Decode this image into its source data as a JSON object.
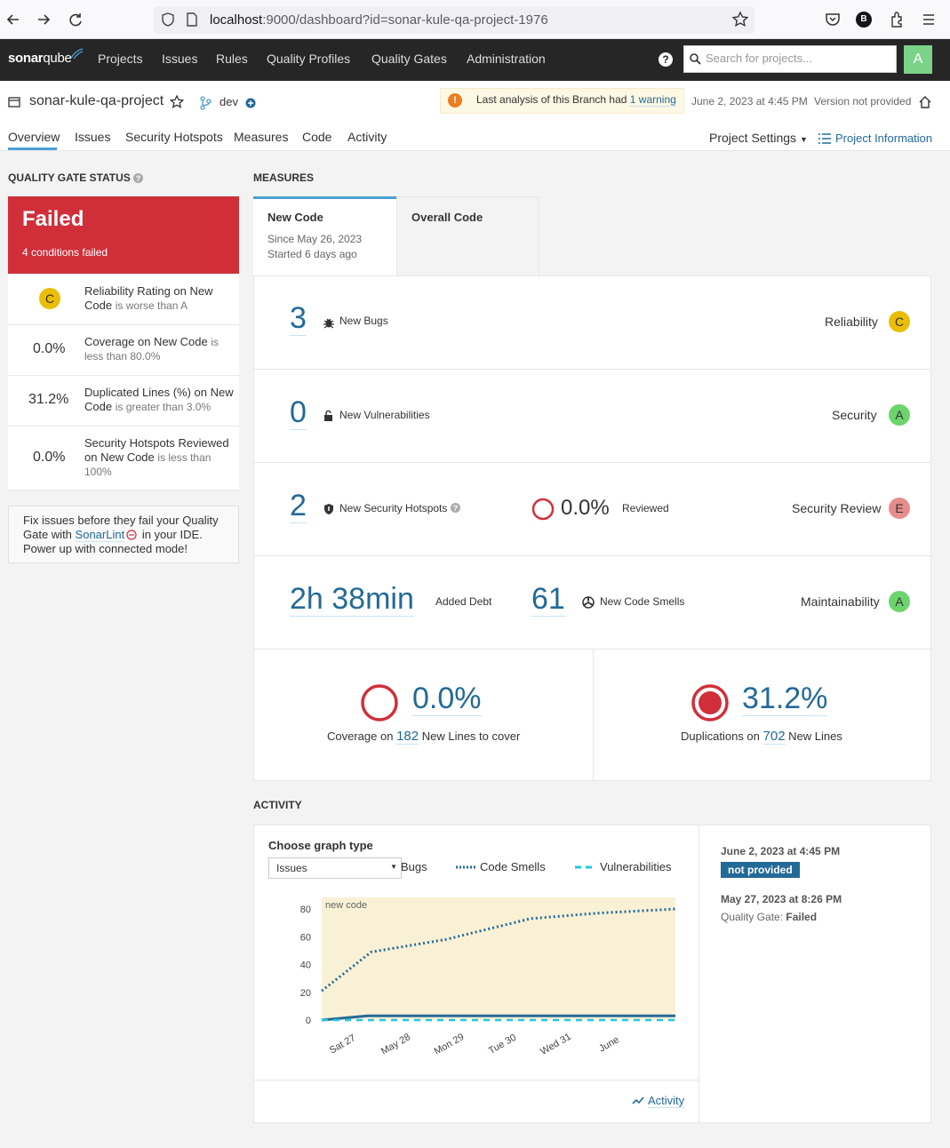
{
  "browser": {
    "url_host": "localhost",
    "url_rest": ":9000/dashboard?id=sonar-kule-qa-project-1976",
    "profile_initial": "B"
  },
  "nav": {
    "logo_bold": "sonar",
    "logo_light": "qube",
    "items": [
      "Projects",
      "Issues",
      "Rules",
      "Quality Profiles",
      "Quality Gates",
      "Administration"
    ],
    "help": "?",
    "search_placeholder": "Search for projects...",
    "avatar": "A"
  },
  "project": {
    "name": "sonar-kule-qa-project",
    "branch": "dev",
    "warning_text": "Last analysis of this Branch had",
    "warning_link": "1 warning",
    "warning_icon": "!",
    "analysis_date": "June 2, 2023 at 4:45 PM",
    "version": "Version not provided",
    "tabs": [
      "Overview",
      "Issues",
      "Security Hotspots",
      "Measures",
      "Code",
      "Activity"
    ],
    "settings": "Project Settings",
    "info": "Project Information"
  },
  "quality_gate": {
    "heading": "QUALITY GATE STATUS",
    "status": "Failed",
    "conditions_failed": "4 conditions failed",
    "conditions": [
      {
        "value": "C",
        "label": "Reliability Rating on New Code",
        "sub": "is worse than A"
      },
      {
        "value": "0.0%",
        "label": "Coverage on New Code",
        "sub": "is less than 80.0%"
      },
      {
        "value": "31.2%",
        "label": "Duplicated Lines (%) on New Code",
        "sub": "is greater than 3.0%"
      },
      {
        "value": "0.0%",
        "label": "Security Hotspots Reviewed on New Code",
        "sub": "is less than 100%"
      }
    ],
    "sonarlint_pre": "Fix issues before they fail your Quality Gate with",
    "sonarlint_link": "SonarLint",
    "sonarlint_post": "in your IDE. Power up with connected mode!"
  },
  "measures": {
    "heading": "MEASURES",
    "tab_new": {
      "title": "New Code",
      "since": "Since May 26, 2023",
      "started": "Started 6 days ago"
    },
    "tab_overall": {
      "title": "Overall Code"
    },
    "bugs": {
      "value": "3",
      "label": "New Bugs",
      "domain": "Reliability",
      "rating": "C"
    },
    "vulnerabilities": {
      "value": "0",
      "label": "New Vulnerabilities",
      "domain": "Security",
      "rating": "A"
    },
    "hotspots": {
      "value": "2",
      "label": "New Security Hotspots",
      "reviewed_value": "0.0%",
      "reviewed_label": "Reviewed",
      "domain": "Security Review",
      "rating": "E"
    },
    "maintainability": {
      "debt": "2h 38min",
      "debt_label": "Added Debt",
      "smells": "61",
      "smells_label": "New Code Smells",
      "domain": "Maintainability",
      "rating": "A"
    },
    "coverage": {
      "value": "0.0%",
      "pre": "Coverage on",
      "lines": "182",
      "post": "New Lines to cover"
    },
    "duplications": {
      "value": "31.2%",
      "pre": "Duplications on",
      "lines": "702",
      "post": "New Lines"
    }
  },
  "activity": {
    "heading": "ACTIVITY",
    "choose": "Choose graph type",
    "graph_type": "Issues",
    "legend": [
      "Bugs",
      "Code Smells",
      "Vulnerabilities"
    ],
    "history": [
      {
        "date": "June 2, 2023 at 4:45 PM",
        "badge": "not provided"
      },
      {
        "date": "May 27, 2023 at 8:26 PM",
        "gate_label": "Quality Gate:",
        "gate_value": "Failed"
      }
    ],
    "link": "Activity"
  },
  "colors": {
    "accent": "#236a97",
    "failed": "#d02f3a",
    "nav_bg": "#262626",
    "new_code_bg": "#f9f1d6"
  },
  "chart_data": {
    "type": "line",
    "annotation": "new code",
    "x": [
      "Sat 27",
      "May 28",
      "Mon 29",
      "Tue 30",
      "Wed 31",
      "June"
    ],
    "ylim": [
      0,
      80
    ],
    "yticks": [
      0,
      20,
      40,
      60,
      80
    ],
    "series": [
      {
        "name": "Bugs",
        "points": [
          [
            0.0,
            0
          ],
          [
            0.13,
            3
          ],
          [
            1.0,
            3
          ]
        ]
      },
      {
        "name": "Code Smells",
        "points": [
          [
            0.0,
            21
          ],
          [
            0.14,
            49
          ],
          [
            0.35,
            58
          ],
          [
            0.59,
            73
          ],
          [
            0.78,
            77
          ],
          [
            1.0,
            80
          ]
        ]
      },
      {
        "name": "Vulnerabilities",
        "points": [
          [
            0.0,
            0
          ],
          [
            1.0,
            0
          ]
        ]
      }
    ]
  }
}
